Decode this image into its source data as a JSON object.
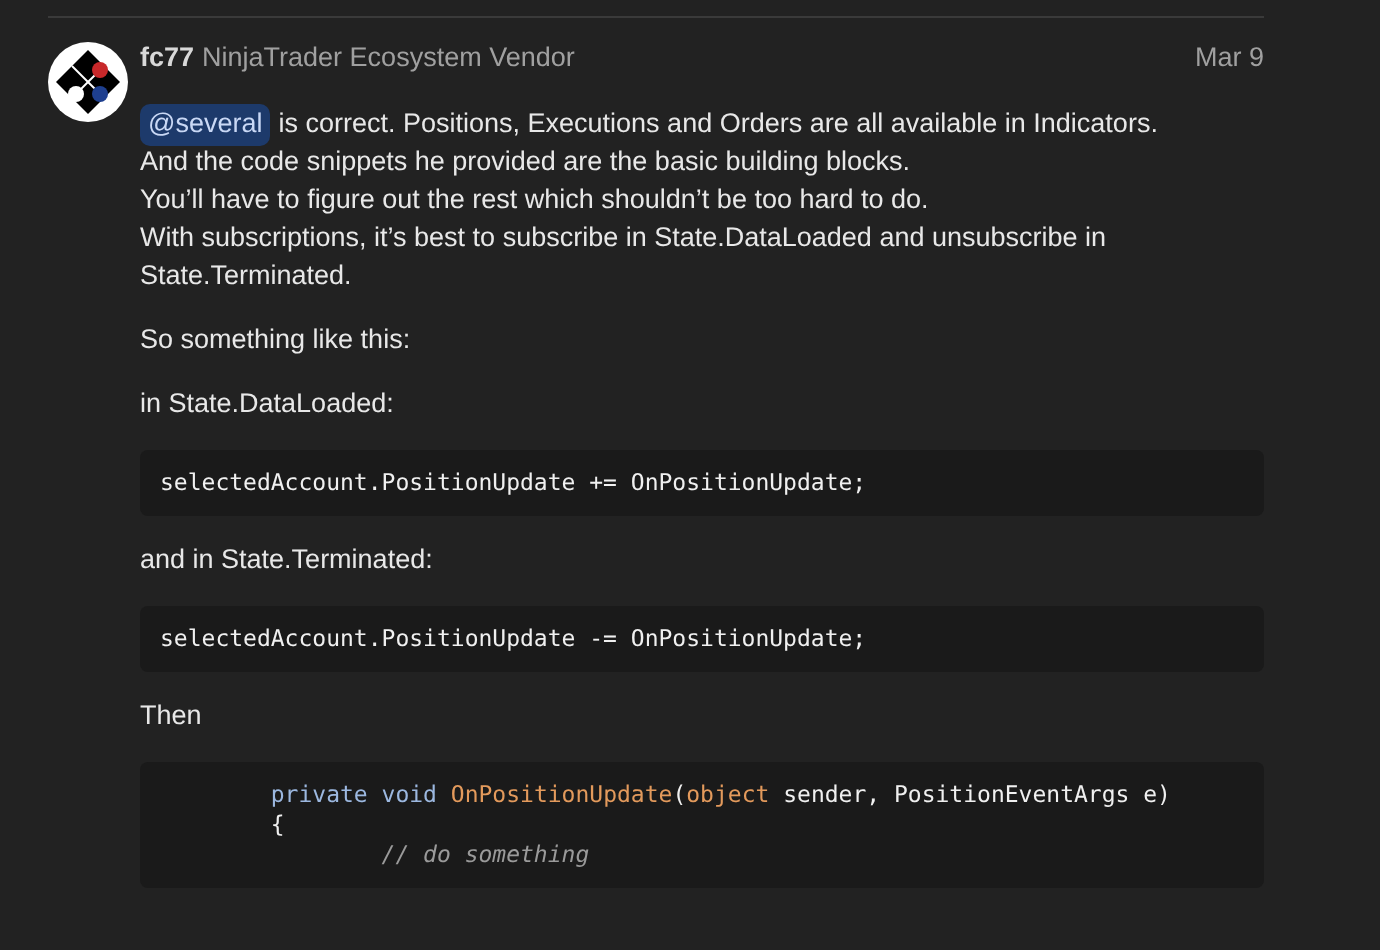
{
  "post": {
    "username": "fc77",
    "user_title": "NinjaTrader Ecosystem Vendor",
    "date": "Mar 9",
    "blocks": [
      {
        "kind": "paragraph",
        "mention": "@several",
        "lines": [
          "is correct. Positions, Executions and Orders are all available in Indicators.",
          "And the code snippets he provided are the basic building blocks.",
          "You’ll have to figure out the rest which shouldn’t be too hard to do.",
          "With subscriptions, it’s best to subscribe in State.DataLoaded and unsubscribe in",
          "State.Terminated."
        ]
      },
      {
        "kind": "paragraph",
        "lines": [
          "So something like this:"
        ]
      },
      {
        "kind": "paragraph",
        "lines": [
          "in State.DataLoaded:"
        ]
      },
      {
        "kind": "code",
        "lines": [
          [
            {
              "kind": "plain",
              "text": "selectedAccount.PositionUpdate += OnPositionUpdate;"
            }
          ]
        ]
      },
      {
        "kind": "paragraph",
        "lines": [
          "and in State.Terminated:"
        ]
      },
      {
        "kind": "code",
        "lines": [
          [
            {
              "kind": "plain",
              "text": "selectedAccount.PositionUpdate -= OnPositionUpdate;"
            }
          ]
        ]
      },
      {
        "kind": "paragraph",
        "lines": [
          "Then"
        ]
      },
      {
        "kind": "code",
        "lines": [
          [
            {
              "kind": "keyword",
              "text": "        private void "
            },
            {
              "kind": "function",
              "text": "OnPositionUpdate"
            },
            {
              "kind": "plain",
              "text": "("
            },
            {
              "kind": "function",
              "text": "object"
            },
            {
              "kind": "plain",
              "text": " sender, PositionEventArgs e)"
            }
          ],
          [
            {
              "kind": "plain",
              "text": "        {"
            }
          ],
          [
            {
              "kind": "comment",
              "text": "                // do something"
            }
          ]
        ]
      }
    ]
  }
}
